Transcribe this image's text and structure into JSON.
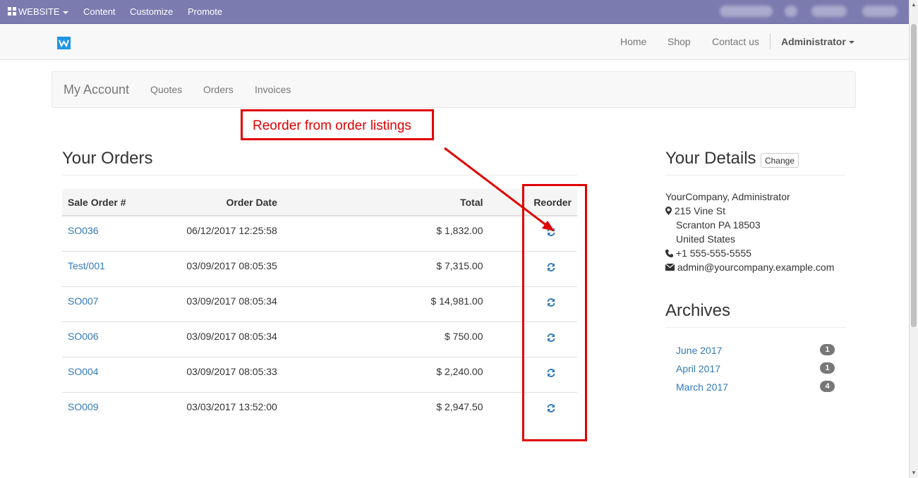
{
  "adminbar": {
    "website_label": "WEBSITE",
    "menu": [
      "Content",
      "Customize",
      "Promote"
    ]
  },
  "header": {
    "nav": [
      "Home",
      "Shop",
      "Contact us"
    ],
    "user": "Administrator"
  },
  "account_nav": {
    "brand": "My Account",
    "links": [
      "Quotes",
      "Orders",
      "Invoices"
    ]
  },
  "callout": {
    "text": "Reorder from order listings"
  },
  "orders": {
    "title": "Your Orders",
    "columns": [
      "Sale Order #",
      "Order Date",
      "Total",
      "Reorder"
    ],
    "rows": [
      {
        "id": "SO036",
        "date": "06/12/2017 12:25:58",
        "total": "$ 1,832.00"
      },
      {
        "id": "Test/001",
        "date": "03/09/2017 08:05:35",
        "total": "$ 7,315.00"
      },
      {
        "id": "SO007",
        "date": "03/09/2017 08:05:34",
        "total": "$ 14,981.00"
      },
      {
        "id": "SO006",
        "date": "03/09/2017 08:05:34",
        "total": "$ 750.00"
      },
      {
        "id": "SO004",
        "date": "03/09/2017 08:05:33",
        "total": "$ 2,240.00"
      },
      {
        "id": "SO009",
        "date": "03/03/2017 13:52:00",
        "total": "$ 2,947.50"
      }
    ]
  },
  "details": {
    "title": "Your Details",
    "change_label": "Change",
    "name": "YourCompany, Administrator",
    "street": "215 Vine St",
    "city": "Scranton PA 18503",
    "country": "United States",
    "phone": "+1 555-555-5555",
    "email": "admin@yourcompany.example.com"
  },
  "archives": {
    "title": "Archives",
    "items": [
      {
        "label": "June 2017",
        "count": "1"
      },
      {
        "label": "April 2017",
        "count": "1"
      },
      {
        "label": "March 2017",
        "count": "4"
      }
    ]
  },
  "colors": {
    "adminbar": "#7b7bb0",
    "link": "#337ab7",
    "annotation": "#e00000",
    "logo": "#1f95e6"
  },
  "icons": [
    "apps-icon",
    "reorder-icon",
    "map-marker-icon",
    "phone-icon",
    "envelope-icon",
    "logo-icon"
  ]
}
